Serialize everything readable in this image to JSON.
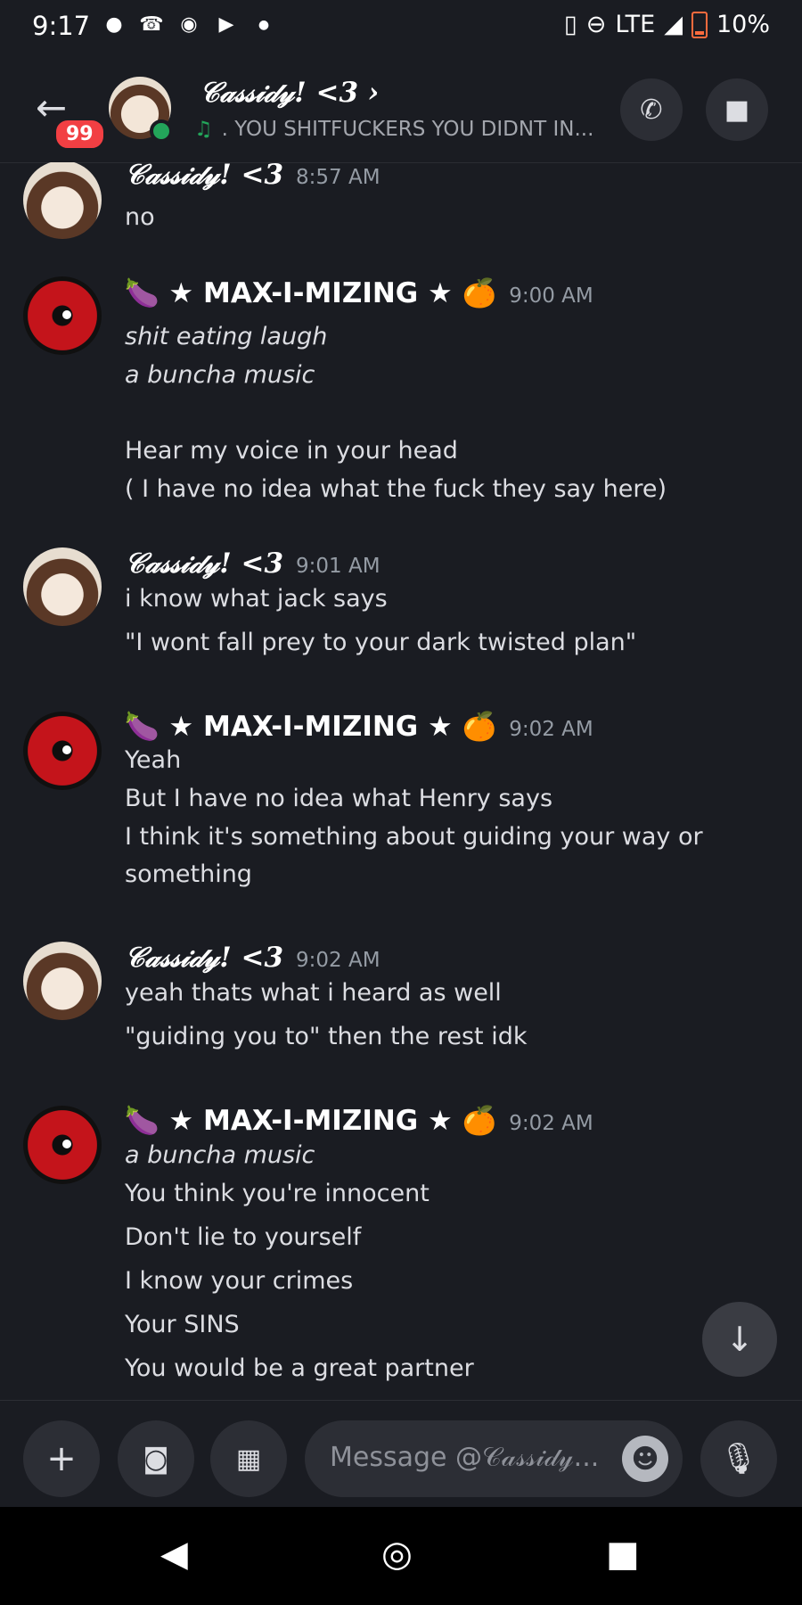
{
  "status_bar": {
    "time": "9:17",
    "network": "LTE",
    "battery": "10%",
    "notif_icons": [
      "chat-bubble-icon",
      "missed-call-icon",
      "spotify-icon",
      "youtube-icon",
      "dot-icon"
    ]
  },
  "header": {
    "back_badge": "99",
    "title": "𝒞𝒶𝓈𝓈𝒾𝒹𝓎! <3 ›",
    "subtitle_prefix": "♫",
    "subtitle": ". YOU SHITFUCKERS YOU DIDNT IN..."
  },
  "messages": [
    {
      "author": "𝒞𝒶𝓈𝓈𝒾𝒹𝓎! <3",
      "time": "8:57 AM",
      "lines": [
        "no"
      ]
    },
    {
      "author": "🍆 ★ MAX-I-MIZING ★ 🍊",
      "time": "9:00 AM",
      "lines": [
        "shit eating laugh",
        "a buncha music",
        "Hear my voice in your head",
        "( I have no idea what the fuck they say here)"
      ]
    },
    {
      "author": "𝒞𝒶𝓈𝓈𝒾𝒹𝓎! <3",
      "time": "9:01 AM",
      "lines": [
        "i know what jack says",
        "\"I wont fall prey to your dark twisted plan\""
      ]
    },
    {
      "author": "🍆 ★ MAX-I-MIZING ★ 🍊",
      "time": "9:02 AM",
      "lines": [
        "Yeah",
        "But I have no idea what Henry says",
        "I think it's something about guiding your way or",
        "something"
      ]
    },
    {
      "author": "𝒞𝒶𝓈𝓈𝒾𝒹𝓎! <3",
      "time": "9:02 AM",
      "lines": [
        "yeah thats what i heard as well",
        "\"guiding you to\" then the rest idk"
      ]
    },
    {
      "author": "🍆 ★ MAX-I-MIZING ★ 🍊",
      "time": "9:02 AM",
      "lines": [
        "a buncha music",
        "You think you're innocent",
        "Don't lie to yourself",
        "I know your crimes",
        "Your SINS",
        "You would be a great partner"
      ]
    }
  ],
  "composer": {
    "placeholder": "Message @𝒞𝒶𝓈𝓈𝒾𝒹𝓎..."
  }
}
